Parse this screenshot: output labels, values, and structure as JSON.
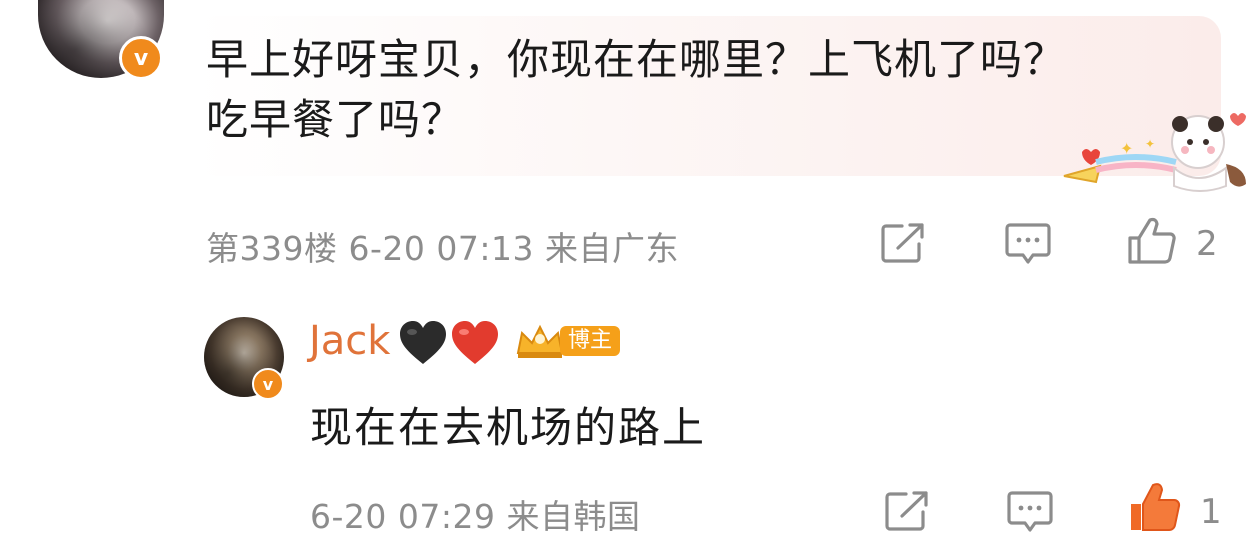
{
  "comment": {
    "line1": "早上好呀宝贝，你现在在哪里？上飞机了吗？",
    "line2": "吃早餐了吗？",
    "meta": "第339楼 6-20 07:13 来自广东",
    "like_count": "2"
  },
  "reply": {
    "username": "Jack",
    "badge_label": "博主",
    "text": "现在在去机场的路上",
    "meta": "6-20 07:29 来自韩国",
    "like_count": "1"
  },
  "icons": {
    "share": "share-icon",
    "reply": "comment-icon",
    "like": "thumbs-up-icon"
  },
  "colors": {
    "username": "#e0733a",
    "liked": "#f06a26",
    "verified_badge": "#f08a1c",
    "meta_gray": "#8c8c8c"
  }
}
